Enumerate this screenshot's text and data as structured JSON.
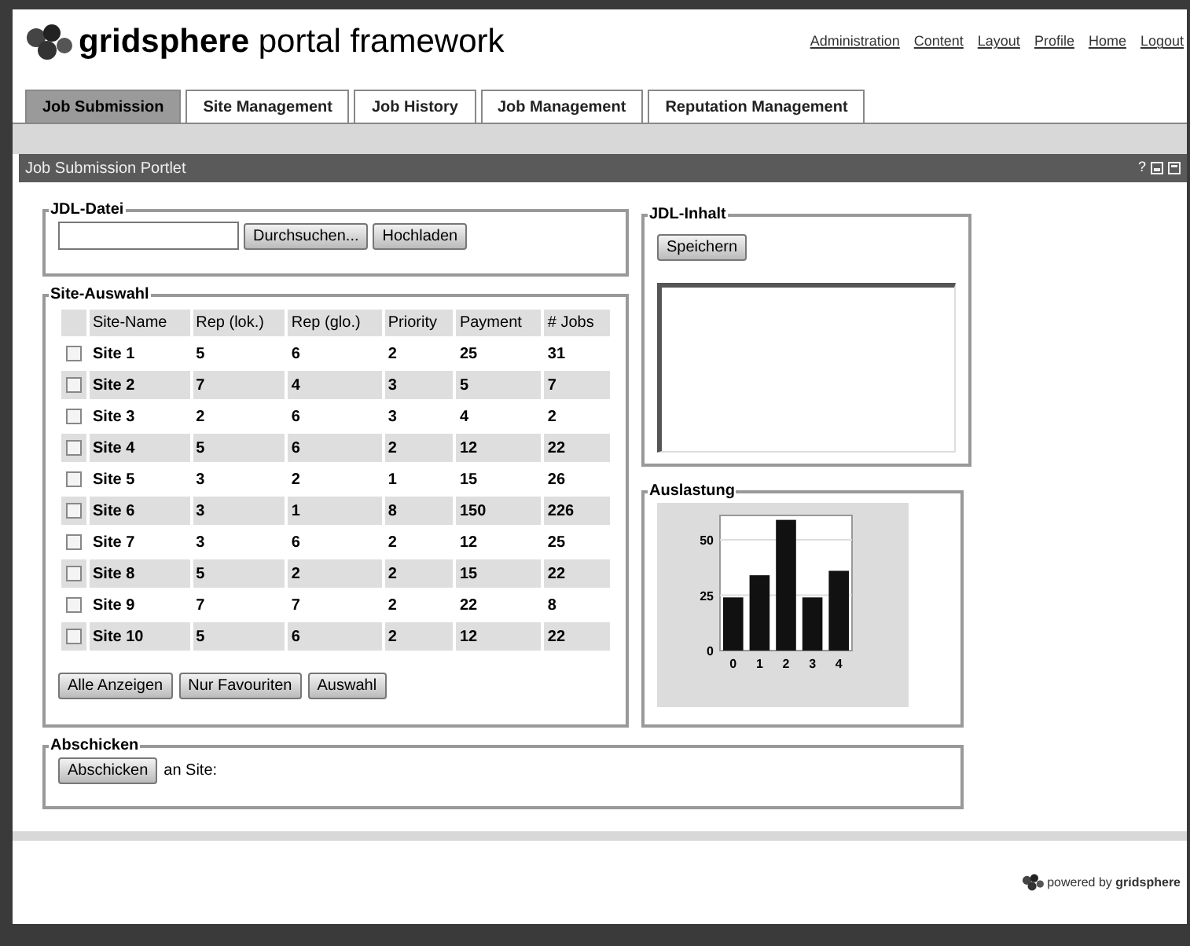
{
  "header": {
    "title": "**gridsphere** portal framework",
    "links": [
      "Administration",
      "Content",
      "Layout",
      "Profile",
      "Home",
      "Logout"
    ]
  },
  "tabs": [
    {
      "label": "Job Submission",
      "selected": true
    },
    {
      "label": "Site Management",
      "selected": false
    },
    {
      "label": "Job History",
      "selected": false
    },
    {
      "label": "Job Management",
      "selected": false
    },
    {
      "label": "Reputation Management",
      "selected": false
    }
  ],
  "portlet": {
    "title": "Job Submission Portlet",
    "help": "?"
  },
  "jdl_datei": {
    "legend": "JDL-Datei",
    "buttons": [
      "Durchsuchen...",
      "Hochladen"
    ]
  },
  "site_auswahl": {
    "legend": "Site-Auswahl",
    "columns": [
      "Site-Name",
      "Rep (lok.)",
      "Rep (glo.)",
      "Priority",
      "Payment",
      "# Jobs"
    ],
    "rows": [
      {
        "checked": false,
        "cells": [
          "Site 1",
          "5",
          "6",
          "2",
          "25",
          "31"
        ]
      },
      {
        "checked": false,
        "cells": [
          "Site 2",
          "7",
          "4",
          "3",
          "5",
          "7"
        ]
      },
      {
        "checked": false,
        "cells": [
          "Site 3",
          "2",
          "6",
          "3",
          "4",
          "2"
        ]
      },
      {
        "checked": false,
        "cells": [
          "Site 4",
          "5",
          "6",
          "2",
          "12",
          "22"
        ]
      },
      {
        "checked": false,
        "cells": [
          "Site 5",
          "3",
          "2",
          "1",
          "15",
          "26"
        ]
      },
      {
        "checked": false,
        "cells": [
          "Site 6",
          "3",
          "1",
          "8",
          "150",
          "226"
        ]
      },
      {
        "checked": false,
        "cells": [
          "Site 7",
          "3",
          "6",
          "2",
          "12",
          "25"
        ]
      },
      {
        "checked": false,
        "cells": [
          "Site 8",
          "5",
          "2",
          "2",
          "15",
          "22"
        ]
      },
      {
        "checked": false,
        "cells": [
          "Site 9",
          "7",
          "7",
          "2",
          "22",
          "8"
        ]
      },
      {
        "checked": false,
        "cells": [
          "Site 10",
          "5",
          "6",
          "2",
          "12",
          "22"
        ]
      }
    ],
    "buttons": [
      "Alle Anzeigen",
      "Nur Favouriten",
      "Auswahl"
    ]
  },
  "jdl_inhalt": {
    "legend": "JDL-Inhalt",
    "button": "Speichern"
  },
  "auslastung": {
    "legend": "Auslastung",
    "chart_data": {
      "type": "bar",
      "categories": [
        "0",
        "1",
        "2",
        "3",
        "4"
      ],
      "series": [
        {
          "color": "#111111",
          "values": [
            24,
            34,
            59,
            24,
            36
          ]
        }
      ],
      "ylim": [
        0,
        61
      ],
      "yticks": [
        0,
        25,
        50
      ]
    }
  },
  "abschicken": {
    "legend": "Abschicken",
    "button": "Abschicken",
    "label": "an Site:"
  },
  "footer": {
    "text": "powered by **gridsphere**"
  }
}
